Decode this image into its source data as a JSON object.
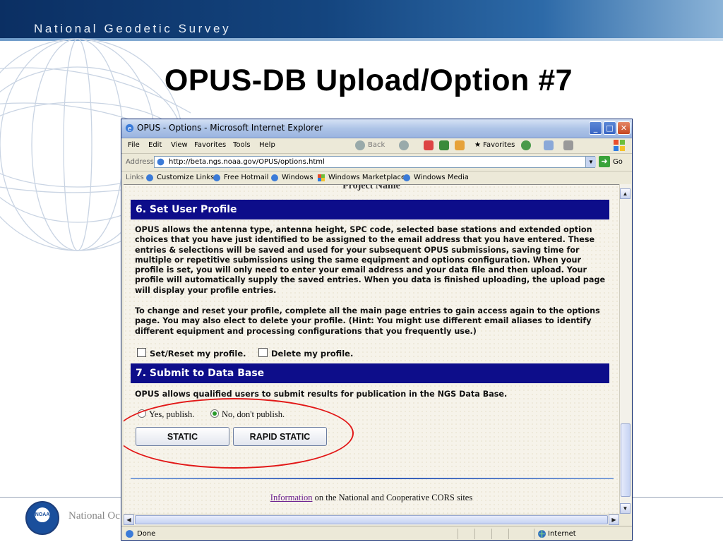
{
  "slide": {
    "header_text": "National Geodetic Survey",
    "title": "OPUS-DB Upload/Option #7",
    "footer_text": "National Oc",
    "logo_text": "NOAA"
  },
  "window": {
    "title": "OPUS - Options - Microsoft Internet Explorer",
    "menu": [
      "File",
      "Edit",
      "View",
      "Favorites",
      "Tools",
      "Help"
    ],
    "toolbar": {
      "back": "Back",
      "favorites": "Favorites"
    },
    "address_label": "Address",
    "url": "http://beta.ngs.noaa.gov/OPUS/options.html",
    "go_label": "Go",
    "links_label": "Links",
    "links": [
      "Customize Links",
      "Free Hotmail",
      "Windows",
      "Windows Marketplace",
      "Windows Media"
    ],
    "status": "Done",
    "zone": "Internet"
  },
  "page": {
    "project_name": "Project Name",
    "section6": {
      "heading": "6. Set User Profile",
      "para1": "OPUS allows the antenna type, antenna height, SPC code, selected base stations and extended option choices that you have just identified to be assigned to the email address that you have entered. These entries & selections will be saved and used for your subsequent OPUS submissions, saving time for multiple or repetitive submissions using the same equipment and options configuration. When your profile is set, you will only need to enter your email address and your data file and then upload. Your profile will automatically supply the saved entries. When you data is finished uploading, the upload page will display your profile entries.",
      "para2": "To change and reset your profile, complete all the main page entries to gain access again to the options page. You may also elect to delete your profile. (Hint: You might use different email aliases to identify different equipment and processing configurations that you frequently use.)",
      "checkbox_reset": "Set/Reset my profile.",
      "checkbox_delete": "Delete my profile."
    },
    "section7": {
      "heading": "7. Submit to Data Base",
      "para": "OPUS allows qualified users to submit results for publication in the NGS Data Base.",
      "radio_yes": "Yes, publish.",
      "radio_no": "No, don't publish.",
      "button_static": "STATIC",
      "button_rapid": "RAPID STATIC"
    },
    "info_link": "Information",
    "info_rest": " on the National and Cooperative CORS sites"
  },
  "colors": {
    "section_header": "#0d0d8a",
    "highlight_ellipse": "#e21717",
    "band": "#14457f"
  }
}
